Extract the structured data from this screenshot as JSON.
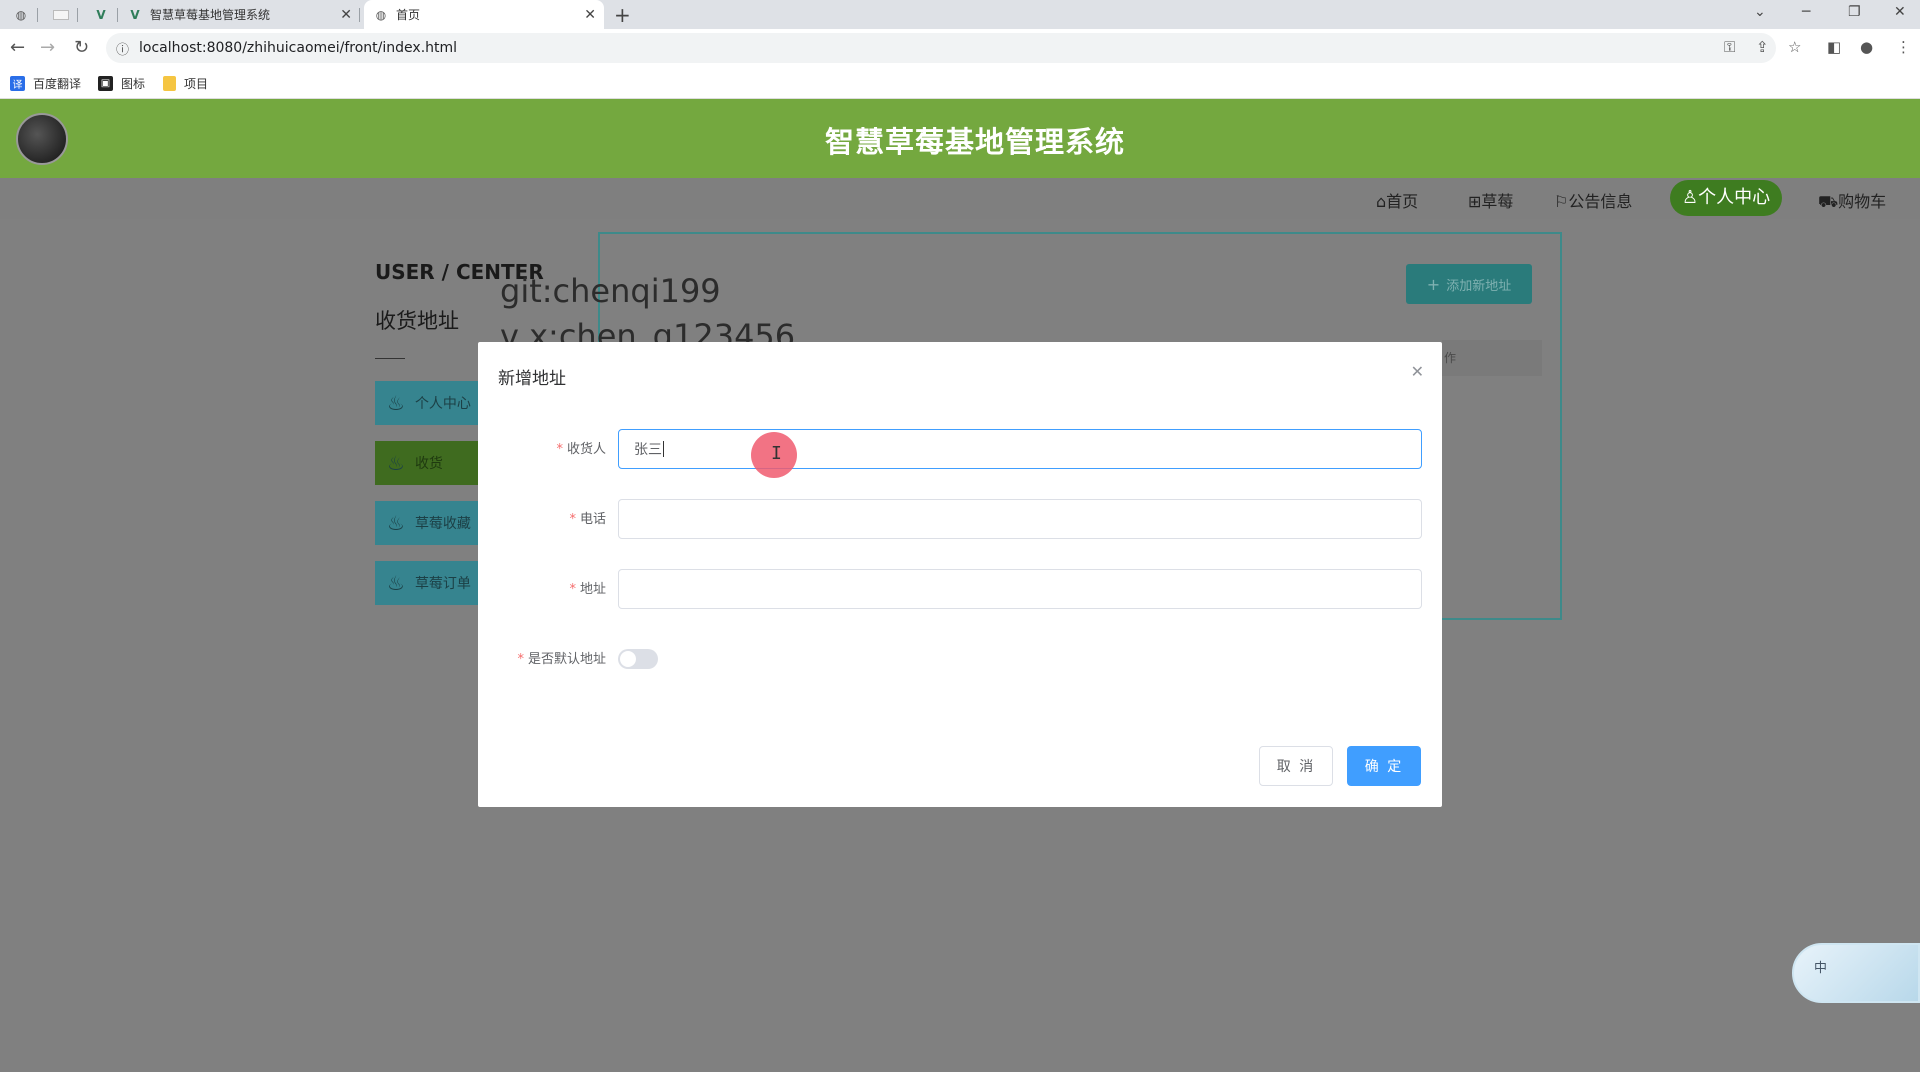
{
  "browser": {
    "tabs": [
      {
        "label": "智慧草莓基地管理系统",
        "icon": "vue-icon"
      },
      {
        "label": "首页",
        "icon": "globe-icon"
      }
    ],
    "url": "localhost:8080/zhihuicaomei/front/index.html",
    "bookmarks": [
      {
        "label": "百度翻译",
        "color": "#2a6ee8"
      },
      {
        "label": "图标",
        "color": "#222222"
      },
      {
        "label": "项目",
        "color": "#f5c542"
      }
    ]
  },
  "site": {
    "title": "智慧草莓基地管理系统",
    "nav": [
      {
        "label": "首页",
        "icon": "home-icon"
      },
      {
        "label": "草莓",
        "icon": "grid-icon"
      },
      {
        "label": "公告信息",
        "icon": "flag-icon"
      },
      {
        "label": "个人中心",
        "icon": "user-icon",
        "active": true
      },
      {
        "label": "购物车",
        "icon": "cart-icon"
      }
    ],
    "header_color": "#74a83f",
    "active_nav_color": "#3e7c20"
  },
  "user_center": {
    "title": "USER / CENTER",
    "subtitle": "收货地址",
    "sidebar": [
      {
        "label": "个人中心",
        "icon": "flame-icon"
      },
      {
        "label": "收货",
        "icon": "flame-icon",
        "active": true
      },
      {
        "label": "草莓收藏",
        "icon": "flame-icon"
      },
      {
        "label": "草莓订单",
        "icon": "flame-icon"
      }
    ],
    "add_button": "添加新地址",
    "table_header_op": "作"
  },
  "watermark": {
    "line1": "git:chenqi199",
    "line2": "v x:chen_q123456"
  },
  "modal": {
    "title": "新增地址",
    "fields": {
      "consignee": {
        "label": "收货人",
        "value": "张三"
      },
      "phone": {
        "label": "电话",
        "value": ""
      },
      "address": {
        "label": "地址",
        "value": ""
      },
      "is_default": {
        "label": "是否默认地址",
        "value": false
      }
    },
    "cancel_label": "取 消",
    "confirm_label": "确 定",
    "primary_color": "#409eff"
  },
  "ime": {
    "label": "中"
  }
}
